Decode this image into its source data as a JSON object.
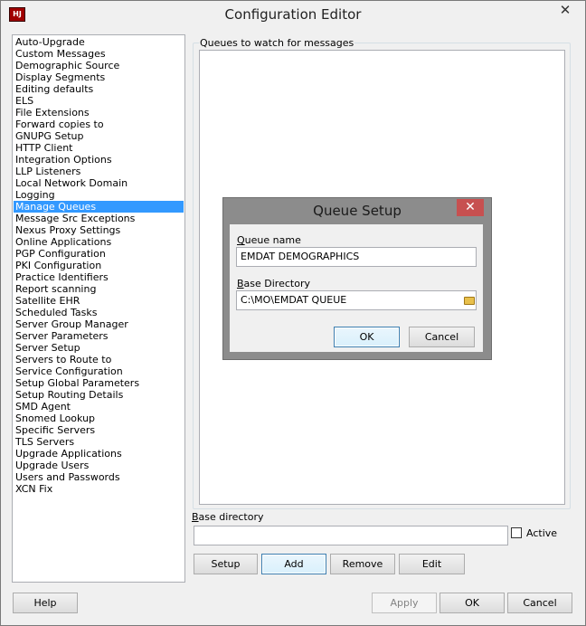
{
  "window": {
    "title": "Configuration Editor",
    "close_glyph": "✕",
    "icon": "app-icon"
  },
  "sidebar": {
    "items": [
      "Auto-Upgrade",
      "Custom Messages",
      "Demographic Source",
      "Display Segments",
      "Editing defaults",
      "ELS",
      "File Extensions",
      "Forward copies to",
      "GNUPG Setup",
      "HTTP Client",
      "Integration Options",
      "LLP Listeners",
      "Local Network Domain",
      "Logging",
      "Manage Queues",
      "Message Src Exceptions",
      "Nexus Proxy Settings",
      "Online Applications",
      "PGP Configuration",
      "PKI Configuration",
      "Practice Identifiers",
      "Report scanning",
      "Satellite EHR",
      "Scheduled Tasks",
      "Server Group Manager",
      "Server Parameters",
      "Server Setup",
      "Servers to Route to",
      "Service Configuration",
      "Setup Global Parameters",
      "Setup Routing Details",
      "SMD Agent",
      "Snomed Lookup",
      "Specific Servers",
      "TLS Servers",
      "Upgrade Applications",
      "Upgrade Users",
      "Users and Passwords",
      "XCN Fix"
    ],
    "selected": "Manage Queues"
  },
  "main": {
    "group_label": "Queues to watch for messages",
    "base_dir_label_first": "B",
    "base_dir_label_rest": "ase directory",
    "base_dir_value": "",
    "active_label": "Active",
    "buttons": {
      "setup": "Setup",
      "add": "Add",
      "remove": "Remove",
      "edit": "Edit"
    }
  },
  "footer": {
    "help": "Help",
    "apply": "Apply",
    "ok": "OK",
    "cancel": "Cancel"
  },
  "dialog": {
    "title": "Queue Setup",
    "close_glyph": "✕",
    "queue_name_label_first": "Q",
    "queue_name_label_rest": "ueue name",
    "queue_name_value": "EMDAT DEMOGRAPHICS",
    "base_dir_label_first": "B",
    "base_dir_label_rest": "ase Directory",
    "base_dir_value": "C:\\MO\\EMDAT QUEUE",
    "ok": "OK",
    "cancel": "Cancel"
  },
  "colors": {
    "selection": "#3399ff",
    "dialog_close": "#c75050"
  }
}
